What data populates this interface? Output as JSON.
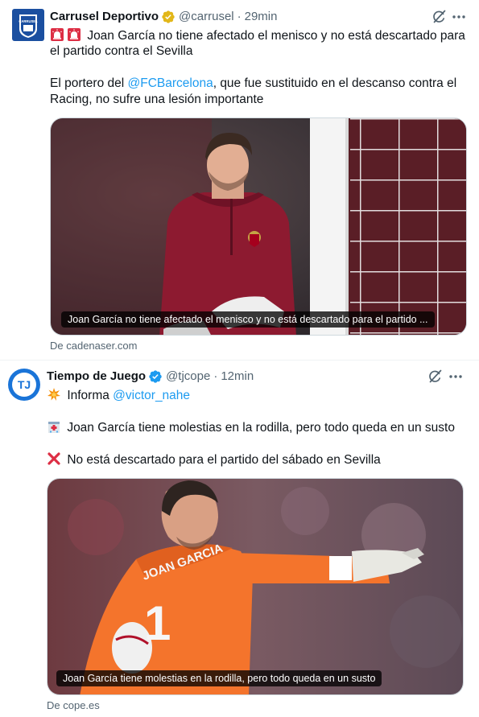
{
  "tweets": [
    {
      "author": {
        "name": "Carrusel Deportivo",
        "handle": "@carrusel",
        "time": "29min",
        "verified": "gold",
        "avatar_text": "CARRUSEL"
      },
      "lines": {
        "l1": "Joan García no tiene afectado el menisco y no está descartado para",
        "l2": "el partido contra el Sevilla",
        "l3a": "El portero del ",
        "l3mention": "@FCBarcelona",
        "l3b": ", que fue sustituido en el descanso contra el",
        "l4": "Racing, no sufre una lesión importante"
      },
      "emojis": [
        "siren-emoji",
        "siren-emoji"
      ],
      "media": {
        "caption": "Joan García no tiene afectado el menisco y no está descartado para el partido ...",
        "source": "De cadenaser.com"
      }
    },
    {
      "author": {
        "name": "Tiempo de Juego",
        "handle": "@tjcope",
        "time": "12min",
        "verified": "blue",
        "avatar_text": "TJ"
      },
      "lines": {
        "l1a": "Informa ",
        "l1mention": "@victor_nahe",
        "l2": "Joan García tiene molestias en la rodilla, pero todo queda en un susto",
        "l3": "No está descartado para el partido del sábado en Sevilla"
      },
      "emojis": [
        "collision-emoji",
        "hospital-emoji",
        "cross-mark-emoji"
      ],
      "media": {
        "caption": "Joan García tiene molestias en la rodilla, pero todo queda en un susto",
        "source": "De cope.es",
        "jersey_number": "1",
        "jersey_name": "JOAN GARCIA"
      }
    }
  ],
  "colors": {
    "link": "#1d9bf0",
    "verified_gold": "#e2b719",
    "verified_blue": "#1d9bf0",
    "secondary_text": "#536471"
  }
}
